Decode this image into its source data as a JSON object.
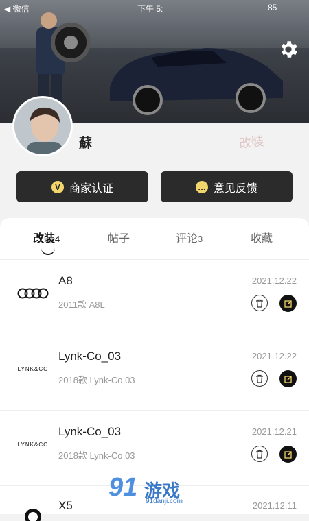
{
  "status_bar": {
    "left": "◀ 微信",
    "time": "下午 5:",
    "battery": "85"
  },
  "profile": {
    "username": "蘇",
    "watermark": "改裝"
  },
  "actions": [
    {
      "label": "商家认证",
      "icon": "v-badge-icon"
    },
    {
      "label": "意见反馈",
      "icon": "chat-bubble-icon"
    }
  ],
  "tabs": [
    {
      "label": "改装",
      "count": "4",
      "active": true
    },
    {
      "label": "帖子",
      "count": ""
    },
    {
      "label": "评论",
      "count": "3"
    },
    {
      "label": "收藏",
      "count": ""
    }
  ],
  "items": [
    {
      "brand": "audi",
      "logo_text": "",
      "title": "A8",
      "subtitle": "2011款 A8L",
      "date": "2021.12.22"
    },
    {
      "brand": "lynk",
      "logo_text": "LYNK&CO",
      "title": "Lynk-Co_03",
      "subtitle": "2018款 Lynk-Co 03",
      "date": "2021.12.22"
    },
    {
      "brand": "lynk",
      "logo_text": "LYNK&CO",
      "title": "Lynk-Co_03",
      "subtitle": "2018款 Lynk-Co 03",
      "date": "2021.12.21"
    },
    {
      "brand": "bmw",
      "logo_text": "",
      "title": "X5",
      "subtitle": "",
      "date": "2021.12.11"
    }
  ],
  "watermark_brand": {
    "text": "游戏",
    "domain": "91danji.com"
  },
  "colors": {
    "accent": "#f2d56b",
    "button_bg": "#2b2b2b"
  }
}
